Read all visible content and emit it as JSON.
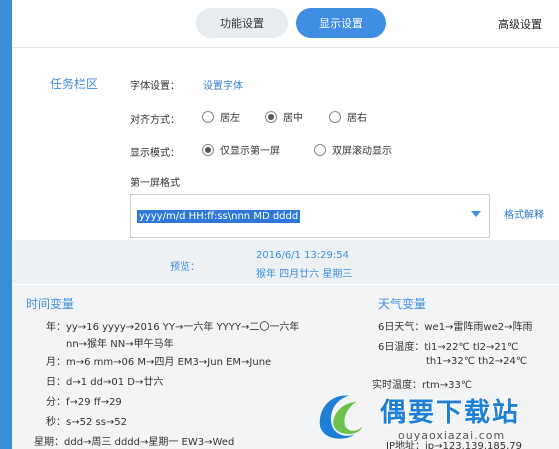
{
  "tabs": {
    "function": "功能设置",
    "display": "显示设置",
    "advanced": "高级设置"
  },
  "section": "任务栏区",
  "font": {
    "label": "字体设置：",
    "link": "设置字体"
  },
  "align": {
    "label": "对齐方式：",
    "options": [
      "居左",
      "居中",
      "居右"
    ],
    "selected": "居中"
  },
  "mode": {
    "label": "显示模式：",
    "options": [
      "仅显示第一屏",
      "双屏滚动显示"
    ],
    "selected": "仅显示第一屏"
  },
  "format": {
    "label": "第一屏格式",
    "value": "yyyy/m/d  HH:ff:ss\\nnn MD dddd",
    "help_link": "格式解释"
  },
  "preview": {
    "label": "预览：",
    "line1": "2016/6/1  13:29:54",
    "line2": "猴年 四月廿六 星期三"
  },
  "time_vars": {
    "title": "时间变量",
    "year_1": "年：yy→16     yyyy→2016     YY→一六年     YYYY→二〇一六年",
    "year_2": "nn→猴年     NN→甲午马年",
    "month": "月：m→6   mm→06   M→四月      EM3→Jun     EM→June",
    "day": "日：d→1              dd→01                D→廿六",
    "minute": "分：f→29              ff→29",
    "second": "秒：s→52              ss→52",
    "week": "星期：ddd→周三       dddd→星期一          EW3→Wed"
  },
  "weather_vars": {
    "title": "天气变量",
    "w6": "6日天气：we1→雷阵雨we2→阵雨",
    "t6a": "6日温度：tl1→22℃     tl2→21℃",
    "t6b": "th1→32℃     th2→24℃",
    "rt": "实时温度：rtm→33℃",
    "ip": "IP地址：ip→123.139.185.79"
  },
  "watermark": {
    "text": "偶要下载站",
    "url": "ouyaoxiazai.com"
  }
}
